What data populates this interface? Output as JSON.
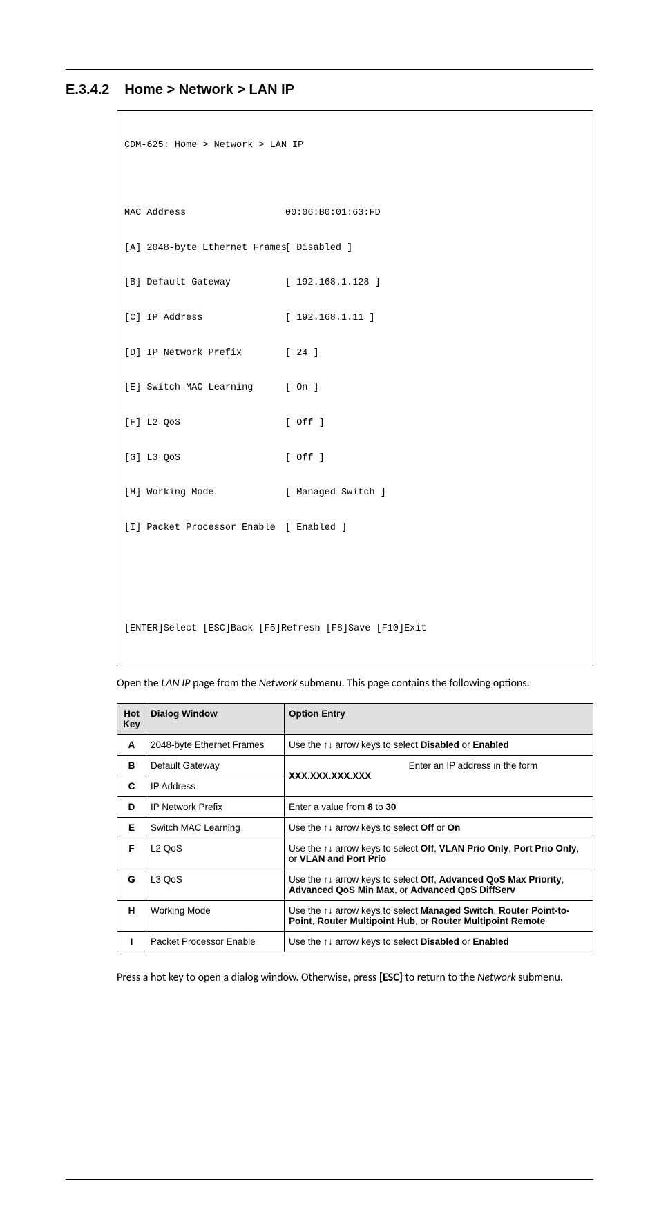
{
  "heading": {
    "number": "E.3.4.2",
    "title": "Home > Network > LAN IP"
  },
  "terminal": {
    "title": "CDM-625: Home > Network > LAN IP",
    "rows": [
      {
        "label": "MAC Address",
        "value": "00:06:B0:01:63:FD"
      },
      {
        "label": "[A] 2048-byte Ethernet Frames",
        "value": "[ Disabled ]"
      },
      {
        "label": "[B] Default Gateway",
        "value": "[ 192.168.1.128 ]"
      },
      {
        "label": "[C] IP Address",
        "value": "[ 192.168.1.11 ]"
      },
      {
        "label": "[D] IP Network Prefix",
        "value": "[ 24 ]"
      },
      {
        "label": "[E] Switch MAC Learning",
        "value": "[ On ]"
      },
      {
        "label": "[F] L2 QoS",
        "value": "[ Off ]"
      },
      {
        "label": "[G] L3 QoS",
        "value": "[ Off ]"
      },
      {
        "label": "[H] Working Mode",
        "value": "[ Managed Switch ]"
      },
      {
        "label": "[I] Packet Processor Enable",
        "value": "[ Enabled ]"
      }
    ],
    "footer": "[ENTER]Select [ESC]Back [F5]Refresh [F8]Save [F10]Exit"
  },
  "intro": {
    "t1": "Open the ",
    "i1": "LAN IP",
    "t2": " page from the ",
    "i2": "Network",
    "t3": " submenu. This page contains the following options:"
  },
  "table": {
    "headers": {
      "hk": "Hot Key",
      "dw": "Dialog Window",
      "oe": "Option Entry"
    },
    "rowA": {
      "hk": "A",
      "dw": "2048-byte Ethernet Frames",
      "p1": "Use the ↑↓ arrow keys to select ",
      "b1": "Disabled",
      "p2": " or ",
      "b2": "Enabled"
    },
    "rowB": {
      "hk": "B",
      "dw": "Default Gateway"
    },
    "rowC": {
      "hk": "C",
      "dw": "IP Address"
    },
    "mergedBC": {
      "right": "Enter an IP address in the form",
      "bold": "XXX.XXX.XXX.XXX"
    },
    "rowD": {
      "hk": "D",
      "dw": "IP Network Prefix",
      "p1": "Enter a value from ",
      "b1": "8",
      "p2": " to ",
      "b2": "30"
    },
    "rowE": {
      "hk": "E",
      "dw": "Switch MAC Learning",
      "p1": "Use the ↑↓ arrow keys to select ",
      "b1": "Off",
      "p2": " or ",
      "b2": "On"
    },
    "rowF": {
      "hk": "F",
      "dw": "L2 QoS",
      "p1": "Use the ↑↓ arrow keys to select ",
      "b1": "Off",
      "p2": ", ",
      "b2": "VLAN Prio Only",
      "p3": ", ",
      "b3": "Port Prio Only",
      "p4": ", or ",
      "b4": "VLAN and Port Prio"
    },
    "rowG": {
      "hk": "G",
      "dw": "L3 QoS",
      "p1": "Use the ↑↓ arrow keys to select ",
      "b1": "Off",
      "p2": ", ",
      "b2": "Advanced QoS Max Priority",
      "p3": ", ",
      "b3": "Advanced QoS Min Max",
      "p4": ",  or ",
      "b4": "Advanced QoS DiffServ"
    },
    "rowH": {
      "hk": "H",
      "dw": "Working Mode",
      "p1": "Use the ↑↓ arrow keys to select ",
      "b1": "Managed Switch",
      "p2": ", ",
      "b2": "Router Point-to-Point",
      "p3": ", ",
      "b3": "Router Multipoint Hub",
      "p4": ", or ",
      "b4": "Router Multipoint Remote"
    },
    "rowI": {
      "hk": "I",
      "dw": "Packet Processor Enable",
      "p1": "Use the ↑↓ arrow keys to select ",
      "b1": "Disabled",
      "p2": " or ",
      "b2": "Enabled"
    }
  },
  "outro": {
    "t1": "Press a hot key to open a dialog window. Otherwise, press ",
    "b1": "[ESC]",
    "t2": " to return to the ",
    "i1": "Network",
    "t3": " submenu."
  }
}
